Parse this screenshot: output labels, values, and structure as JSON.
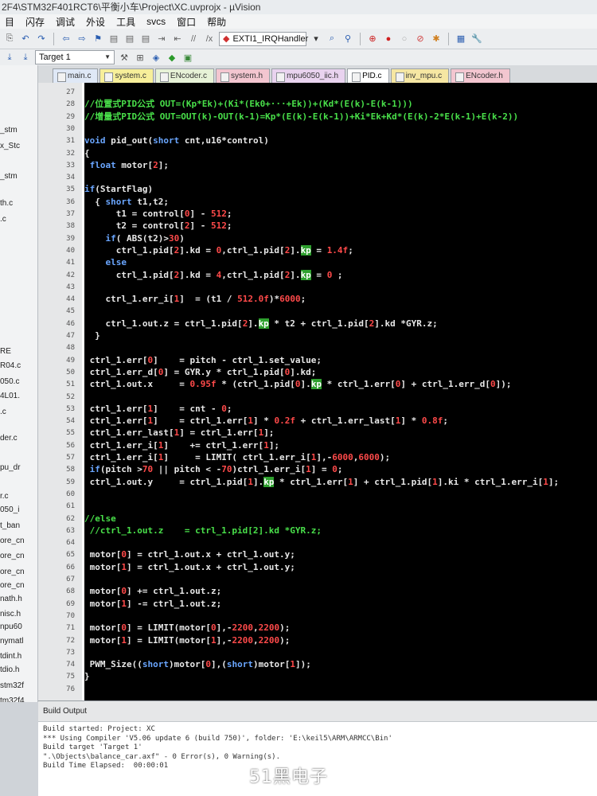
{
  "window": {
    "title": "2F4\\STM32F401RCT6\\平衡小车\\Project\\XC.uvprojx - µVision"
  },
  "menu": [
    "目",
    "闪存",
    "调试",
    "外设",
    "工具",
    "svcs",
    "窗口",
    "帮助"
  ],
  "toolbar": {
    "function_combo": "EXTI1_IRQHandler",
    "target_combo": "Target 1"
  },
  "sidebar_items": [
    "_stm",
    "x_Stc",
    "_stm",
    "th.c",
    ".c",
    "RE",
    "R04.c",
    "050.c",
    "4L01.",
    ".c",
    "der.c",
    "pu_dr",
    "r.c",
    "050_i",
    "t_ban",
    "ore_cn",
    "ore_cn",
    "ore_cn",
    "ore_cn",
    "nath.h",
    "nisc.h",
    "npu60",
    "nymatl",
    "tdint.h",
    "tdio.h",
    "stm32f",
    "tm32f4",
    "tm32f4",
    "tm32f4",
    "tm32f4",
    "tm32f4",
    "stm32f"
  ],
  "tabs": [
    {
      "label": "main.c",
      "color": "#dfe8f6"
    },
    {
      "label": "system.c",
      "color": "#f7ef9a"
    },
    {
      "label": "ENcoder.c",
      "color": "#e7f2d7"
    },
    {
      "label": "system.h",
      "color": "#f3c6d0"
    },
    {
      "label": "mpu6050_iic.h",
      "color": "#e9d3ef"
    },
    {
      "label": "PID.c",
      "color": "#ffffff"
    },
    {
      "label": "inv_mpu.c",
      "color": "#f6e7a3"
    },
    {
      "label": "ENcoder.h",
      "color": "#f3c6d0"
    }
  ],
  "active_tab": "PID.c",
  "line_numbers": [
    27,
    28,
    29,
    30,
    31,
    32,
    33,
    34,
    35,
    36,
    37,
    38,
    39,
    40,
    41,
    42,
    43,
    44,
    45,
    46,
    47,
    48,
    49,
    50,
    51,
    52,
    53,
    54,
    55,
    56,
    57,
    58,
    59,
    60,
    61,
    62,
    63,
    64,
    65,
    66,
    67,
    68,
    69,
    70,
    71,
    72,
    73,
    74,
    75,
    76
  ],
  "code_lines": [
    [],
    [
      [
        "cm",
        "//位置式PID公式 OUT=(Kp*Ek)+(Ki*(Ek0+···+Ek))+(Kd*(E(k)-E(k-1)))"
      ]
    ],
    [
      [
        "cm",
        "//增量式PID公式 OUT=OUT(k)-OUT(k-1)=Kp*(E(k)-E(k-1))+Ki*Ek+Kd*(E(k)-2*E(k-1)+E(k-2))"
      ]
    ],
    [],
    [
      [
        "kw",
        "void"
      ],
      [
        "",
        " pid_out("
      ],
      [
        "kw",
        "short"
      ],
      [
        "",
        " cnt,u16*control)"
      ]
    ],
    [
      [
        "",
        "{"
      ]
    ],
    [
      [
        "",
        " "
      ],
      [
        "kw",
        "float"
      ],
      [
        "",
        " motor["
      ],
      [
        "num",
        "2"
      ],
      [
        "",
        "];"
      ]
    ],
    [],
    [
      [
        "kw",
        "if"
      ],
      [
        "",
        "(StartFlag)"
      ]
    ],
    [
      [
        "",
        "  { "
      ],
      [
        "kw",
        "short"
      ],
      [
        "",
        " t1,t2;"
      ]
    ],
    [
      [
        "",
        "      t1 = control["
      ],
      [
        "num",
        "0"
      ],
      [
        "",
        "] - "
      ],
      [
        "num",
        "512"
      ],
      [
        "",
        ";"
      ]
    ],
    [
      [
        "",
        "      t2 = control["
      ],
      [
        "num",
        "2"
      ],
      [
        "",
        "] - "
      ],
      [
        "num",
        "512"
      ],
      [
        "",
        ";"
      ]
    ],
    [
      [
        "",
        "    "
      ],
      [
        "kw",
        "if"
      ],
      [
        "",
        "( ABS(t2)>"
      ],
      [
        "num",
        "30"
      ],
      [
        "",
        ")"
      ]
    ],
    [
      [
        "",
        "      ctrl_1.pid["
      ],
      [
        "num",
        "2"
      ],
      [
        "",
        "].kd = "
      ],
      [
        "num",
        "0"
      ],
      [
        "",
        ",ctrl_1.pid["
      ],
      [
        "num",
        "2"
      ],
      [
        "",
        "]."
      ],
      [
        "hl",
        "kp"
      ],
      [
        "",
        " = "
      ],
      [
        "num",
        "1.4f"
      ],
      [
        "",
        ";"
      ]
    ],
    [
      [
        "",
        "    "
      ],
      [
        "kw",
        "else"
      ]
    ],
    [
      [
        "",
        "      ctrl_1.pid["
      ],
      [
        "num",
        "2"
      ],
      [
        "",
        "].kd = "
      ],
      [
        "num",
        "4"
      ],
      [
        "",
        ",ctrl_1.pid["
      ],
      [
        "num",
        "2"
      ],
      [
        "",
        "]."
      ],
      [
        "hl",
        "kp"
      ],
      [
        "",
        " = "
      ],
      [
        "num",
        "0"
      ],
      [
        "",
        " ;"
      ]
    ],
    [],
    [
      [
        "",
        "    ctrl_1.err_i["
      ],
      [
        "num",
        "1"
      ],
      [
        "",
        "]  = (t1 / "
      ],
      [
        "num",
        "512.0f"
      ],
      [
        "",
        ")*"
      ],
      [
        "num",
        "6000"
      ],
      [
        "",
        ";"
      ]
    ],
    [],
    [
      [
        "",
        "    ctrl_1.out.z = ctrl_1.pid["
      ],
      [
        "num",
        "2"
      ],
      [
        "",
        "]."
      ],
      [
        "hl",
        "kp"
      ],
      [
        "",
        " * t2 + ctrl_1.pid["
      ],
      [
        "num",
        "2"
      ],
      [
        "",
        "].kd *GYR.z;"
      ]
    ],
    [
      [
        "",
        "  }"
      ]
    ],
    [],
    [
      [
        "",
        " ctrl_1.err["
      ],
      [
        "num",
        "0"
      ],
      [
        "",
        "]    = pitch - ctrl_1.set_value;"
      ]
    ],
    [
      [
        "",
        " ctrl_1.err_d["
      ],
      [
        "num",
        "0"
      ],
      [
        "",
        "] = GYR.y * ctrl_1.pid["
      ],
      [
        "num",
        "0"
      ],
      [
        "",
        "].kd;"
      ]
    ],
    [
      [
        "",
        " ctrl_1.out.x     = "
      ],
      [
        "num",
        "0.95f"
      ],
      [
        "",
        " * (ctrl_1.pid["
      ],
      [
        "num",
        "0"
      ],
      [
        "",
        "]."
      ],
      [
        "hl",
        "kp"
      ],
      [
        "",
        " * ctrl_1.err["
      ],
      [
        "num",
        "0"
      ],
      [
        "",
        "] + ctrl_1.err_d["
      ],
      [
        "num",
        "0"
      ],
      [
        "",
        "]);"
      ]
    ],
    [],
    [
      [
        "",
        " ctrl_1.err["
      ],
      [
        "num",
        "1"
      ],
      [
        "",
        "]    = cnt - "
      ],
      [
        "num",
        "0"
      ],
      [
        "",
        ";"
      ]
    ],
    [
      [
        "",
        " ctrl_1.err["
      ],
      [
        "num",
        "1"
      ],
      [
        "",
        "]    = ctrl_1.err["
      ],
      [
        "num",
        "1"
      ],
      [
        "",
        "] * "
      ],
      [
        "num",
        "0.2f"
      ],
      [
        "",
        " + ctrl_1.err_last["
      ],
      [
        "num",
        "1"
      ],
      [
        "",
        "] * "
      ],
      [
        "num",
        "0.8f"
      ],
      [
        "",
        ";"
      ]
    ],
    [
      [
        "",
        " ctrl_1.err_last["
      ],
      [
        "num",
        "1"
      ],
      [
        "",
        "] = ctrl_1.err["
      ],
      [
        "num",
        "1"
      ],
      [
        "",
        "];"
      ]
    ],
    [
      [
        "",
        " ctrl_1.err_i["
      ],
      [
        "num",
        "1"
      ],
      [
        "",
        "]    += ctrl_1.err["
      ],
      [
        "num",
        "1"
      ],
      [
        "",
        "];"
      ]
    ],
    [
      [
        "",
        " ctrl_1.err_i["
      ],
      [
        "num",
        "1"
      ],
      [
        "",
        "]     = LIMIT( ctrl_1.err_i["
      ],
      [
        "num",
        "1"
      ],
      [
        "",
        "],-"
      ],
      [
        "num",
        "6000"
      ],
      [
        "",
        ","
      ],
      [
        "num",
        "6000"
      ],
      [
        "",
        ");"
      ]
    ],
    [
      [
        "",
        " "
      ],
      [
        "kw",
        "if"
      ],
      [
        "",
        "(pitch >"
      ],
      [
        "num",
        "70"
      ],
      [
        "",
        " || pitch < -"
      ],
      [
        "num",
        "70"
      ],
      [
        "",
        ")ctrl_1.err_i["
      ],
      [
        "num",
        "1"
      ],
      [
        "",
        "] = "
      ],
      [
        "num",
        "0"
      ],
      [
        "",
        ";"
      ]
    ],
    [
      [
        "",
        " ctrl_1.out.y     = ctrl_1.pid["
      ],
      [
        "num",
        "1"
      ],
      [
        "",
        "]."
      ],
      [
        "hl",
        "kp"
      ],
      [
        "",
        " * ctrl_1.err["
      ],
      [
        "num",
        "1"
      ],
      [
        "",
        "] + ctrl_1.pid["
      ],
      [
        "num",
        "1"
      ],
      [
        "",
        "].ki * ctrl_1.err_i["
      ],
      [
        "num",
        "1"
      ],
      [
        "",
        "];"
      ]
    ],
    [],
    [],
    [
      [
        "cm",
        "//else"
      ]
    ],
    [
      [
        "cm",
        " //ctrl_1.out.z    = ctrl_1.pid[2].kd *GYR.z;"
      ]
    ],
    [],
    [
      [
        "",
        " motor["
      ],
      [
        "num",
        "0"
      ],
      [
        "",
        "] = ctrl_1.out.x + ctrl_1.out.y;"
      ]
    ],
    [
      [
        "",
        " motor["
      ],
      [
        "num",
        "1"
      ],
      [
        "",
        "] = ctrl_1.out.x + ctrl_1.out.y;"
      ]
    ],
    [],
    [
      [
        "",
        " motor["
      ],
      [
        "num",
        "0"
      ],
      [
        "",
        "] += ctrl_1.out.z;"
      ]
    ],
    [
      [
        "",
        " motor["
      ],
      [
        "num",
        "1"
      ],
      [
        "",
        "] -= ctrl_1.out.z;"
      ]
    ],
    [],
    [
      [
        "",
        " motor["
      ],
      [
        "num",
        "0"
      ],
      [
        "",
        "] = LIMIT(motor["
      ],
      [
        "num",
        "0"
      ],
      [
        "",
        "],-"
      ],
      [
        "num",
        "2200"
      ],
      [
        "",
        ","
      ],
      [
        "num",
        "2200"
      ],
      [
        "",
        ");"
      ]
    ],
    [
      [
        "",
        " motor["
      ],
      [
        "num",
        "1"
      ],
      [
        "",
        "] = LIMIT(motor["
      ],
      [
        "num",
        "1"
      ],
      [
        "",
        "],-"
      ],
      [
        "num",
        "2200"
      ],
      [
        "",
        ","
      ],
      [
        "num",
        "2200"
      ],
      [
        "",
        ");"
      ]
    ],
    [],
    [
      [
        "",
        " PWM_Size(("
      ],
      [
        "kw",
        "short"
      ],
      [
        "",
        ")motor["
      ],
      [
        "num",
        "0"
      ],
      [
        "",
        "],("
      ],
      [
        "kw",
        "short"
      ],
      [
        "",
        ")motor["
      ],
      [
        "num",
        "1"
      ],
      [
        "",
        "]);"
      ]
    ],
    [
      [
        "",
        "}"
      ]
    ],
    []
  ],
  "build_output": {
    "title": "Build Output",
    "lines": [
      "Build started: Project: XC",
      "*** Using Compiler 'V5.06 update 6 (build 750)', folder: 'E:\\keil5\\ARM\\ARMCC\\Bin'",
      "Build target 'Target 1'",
      "\".\\Objects\\balance_car.axf\" - 0 Error(s), 0 Warning(s).",
      "Build Time Elapsed:  00:00:01"
    ]
  },
  "watermark": "51黑电子"
}
